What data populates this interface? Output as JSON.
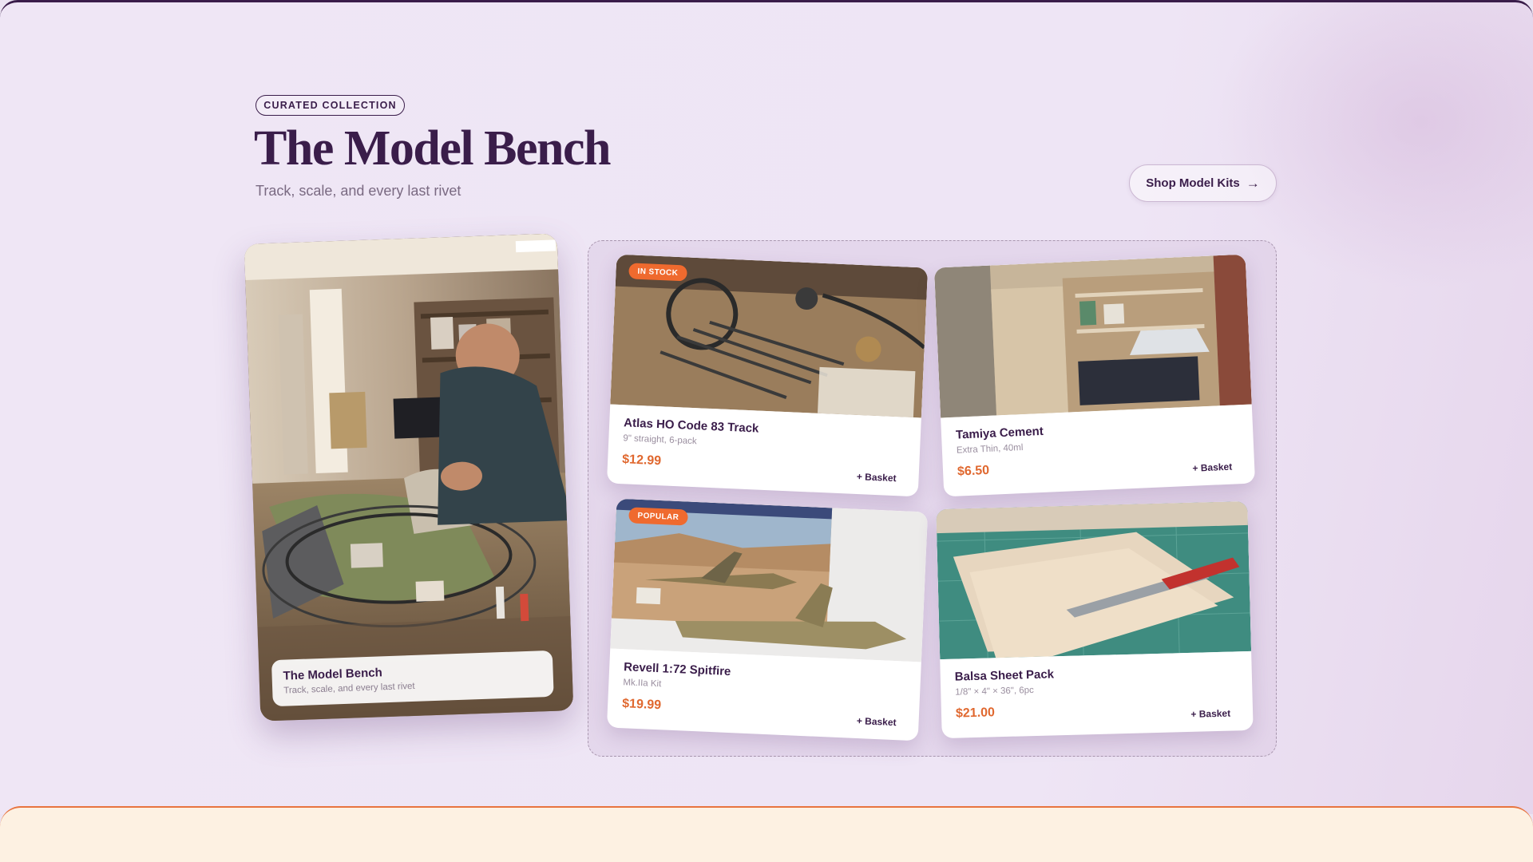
{
  "header": {
    "pill": "CURATED COLLECTION",
    "title": "The Model Bench",
    "subtitle": "Track, scale, and every last rivet",
    "shop_button": "Shop Model Kits"
  },
  "hero": {
    "caption_title": "The Model Bench",
    "caption_sub": "Track, scale, and every last rivet"
  },
  "products": [
    {
      "name": "Atlas HO Code 83 Track",
      "desc": "9\" straight, 6-pack",
      "price": "$12.99",
      "basket": "+ Basket",
      "badge": "IN STOCK"
    },
    {
      "name": "Tamiya Cement",
      "desc": "Extra Thin, 40ml",
      "price": "$6.50",
      "basket": "+ Basket"
    },
    {
      "name": "Revell 1:72 Spitfire",
      "desc": "Mk.IIa Kit",
      "price": "$19.99",
      "basket": "+ Basket",
      "badge": "POPULAR"
    },
    {
      "name": "Balsa Sheet Pack",
      "desc": "1/8\" × 4\" × 36\", 6pc",
      "price": "$21.00",
      "basket": "+ Basket"
    }
  ],
  "colors": {
    "brand": "#3a1d4a",
    "accent": "#e0682f",
    "badge": "#ef6a2e",
    "background": "#efe6f5"
  },
  "icons": {
    "shop_arrow": "arrow-right-icon"
  }
}
